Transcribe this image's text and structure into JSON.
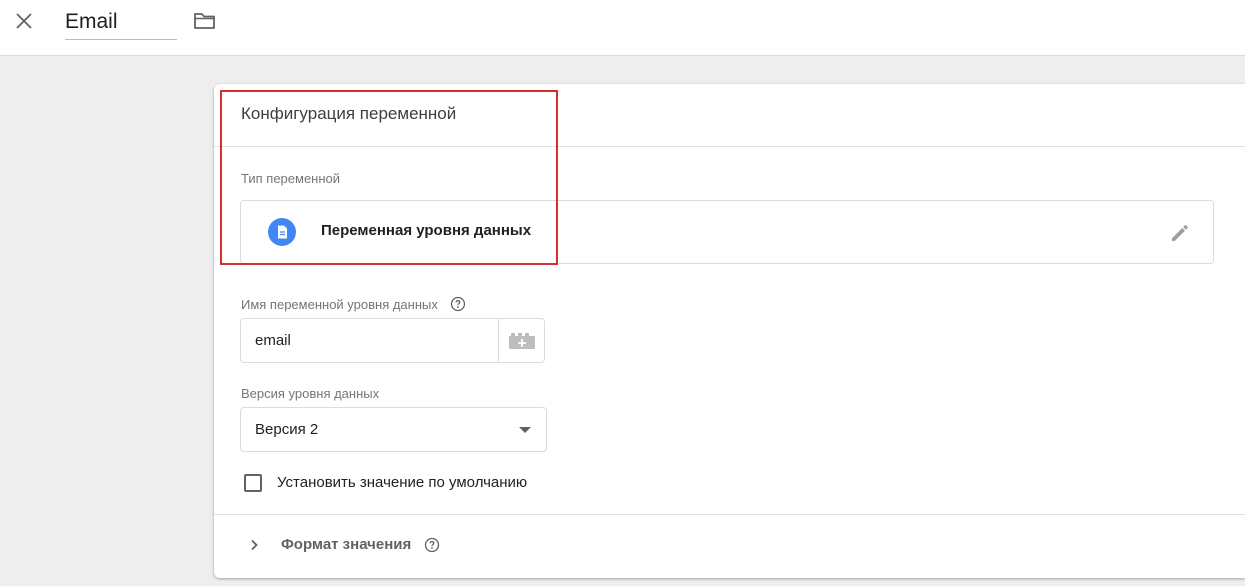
{
  "topbar": {
    "close_icon": "close-icon",
    "variable_name": "Email",
    "folder_icon": "folder-icon"
  },
  "config": {
    "title": "Конфигурация переменной",
    "type_label": "Тип переменной",
    "type_name": "Переменная уровня данных",
    "type_icon": "document-icon",
    "type_icon_color": "#4285f4",
    "edit_icon": "pencil-icon",
    "dl_name_label": "Имя переменной уровня данных",
    "dl_name_value": "email",
    "variable_picker_icon": "add-variable-icon",
    "version_label": "Версия уровня данных",
    "version_value": "Версия 2",
    "default_value_label": "Установить значение по умолчанию",
    "default_value_checked": false,
    "format_label": "Формат значения"
  },
  "colors": {
    "highlight": "#d32f2f",
    "accent": "#4285f4"
  }
}
